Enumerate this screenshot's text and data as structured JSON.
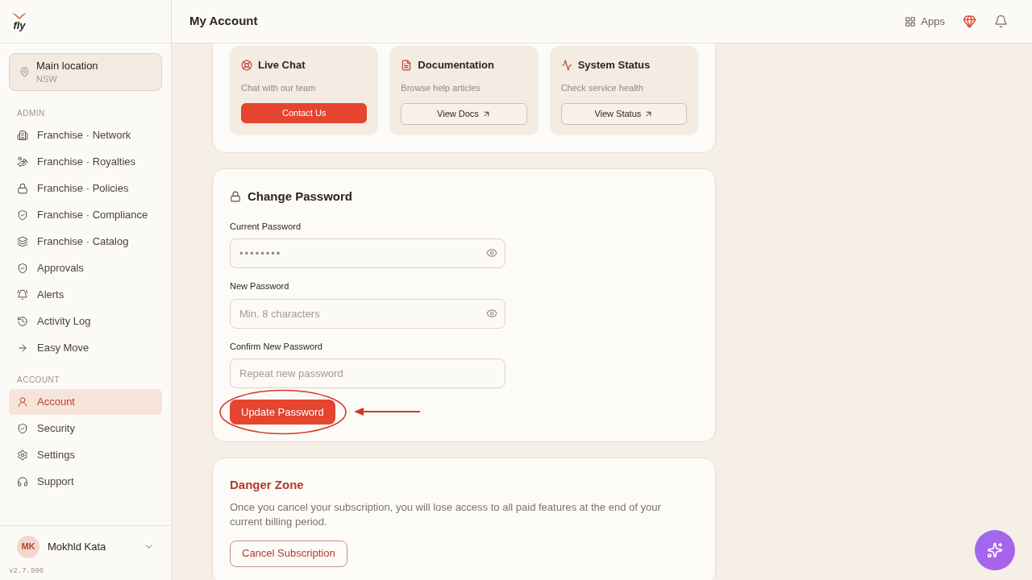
{
  "brand": {
    "logo_text": "fly"
  },
  "header": {
    "title": "My Account",
    "apps_label": "Apps"
  },
  "location": {
    "name": "Main location",
    "region": "NSW"
  },
  "nav_sections": [
    {
      "heading": "ADMIN",
      "items": [
        {
          "label": "Franchise · Network",
          "selected": false
        },
        {
          "label": "Franchise · Royalties",
          "selected": false
        },
        {
          "label": "Franchise · Policies",
          "selected": false
        },
        {
          "label": "Franchise · Compliance",
          "selected": false
        },
        {
          "label": "Franchise · Catalog",
          "selected": false
        },
        {
          "label": "Approvals",
          "selected": false
        },
        {
          "label": "Alerts",
          "selected": false
        },
        {
          "label": "Activity Log",
          "selected": false
        },
        {
          "label": "Easy Move",
          "selected": false
        }
      ]
    },
    {
      "heading": "ACCOUNT",
      "items": [
        {
          "label": "Account",
          "selected": true
        },
        {
          "label": "Security",
          "selected": false
        },
        {
          "label": "Settings",
          "selected": false
        },
        {
          "label": "Support",
          "selected": false
        }
      ]
    }
  ],
  "user": {
    "initials": "MK",
    "name": "Mokhld Kata"
  },
  "version": "v2.7.996",
  "support_cards": [
    {
      "title": "Live Chat",
      "subtitle": "Chat with our team",
      "button": "Contact Us",
      "kind": "primary"
    },
    {
      "title": "Documentation",
      "subtitle": "Browse help articles",
      "button": "View Docs",
      "kind": "external"
    },
    {
      "title": "System Status",
      "subtitle": "Check service health",
      "button": "View Status",
      "kind": "external"
    }
  ],
  "change_password": {
    "title": "Change Password",
    "fields": [
      {
        "label": "Current Password",
        "value": "••••••••",
        "eye": true
      },
      {
        "label": "New Password",
        "placeholder": "Min. 8 characters",
        "eye": true
      },
      {
        "label": "Confirm New Password",
        "placeholder": "Repeat new password",
        "eye": false
      }
    ],
    "button": "Update Password"
  },
  "danger_zone": {
    "title": "Danger Zone",
    "text": "Once you cancel your subscription, you will lose access to all paid features at the end of your current billing period.",
    "button": "Cancel Subscription"
  }
}
